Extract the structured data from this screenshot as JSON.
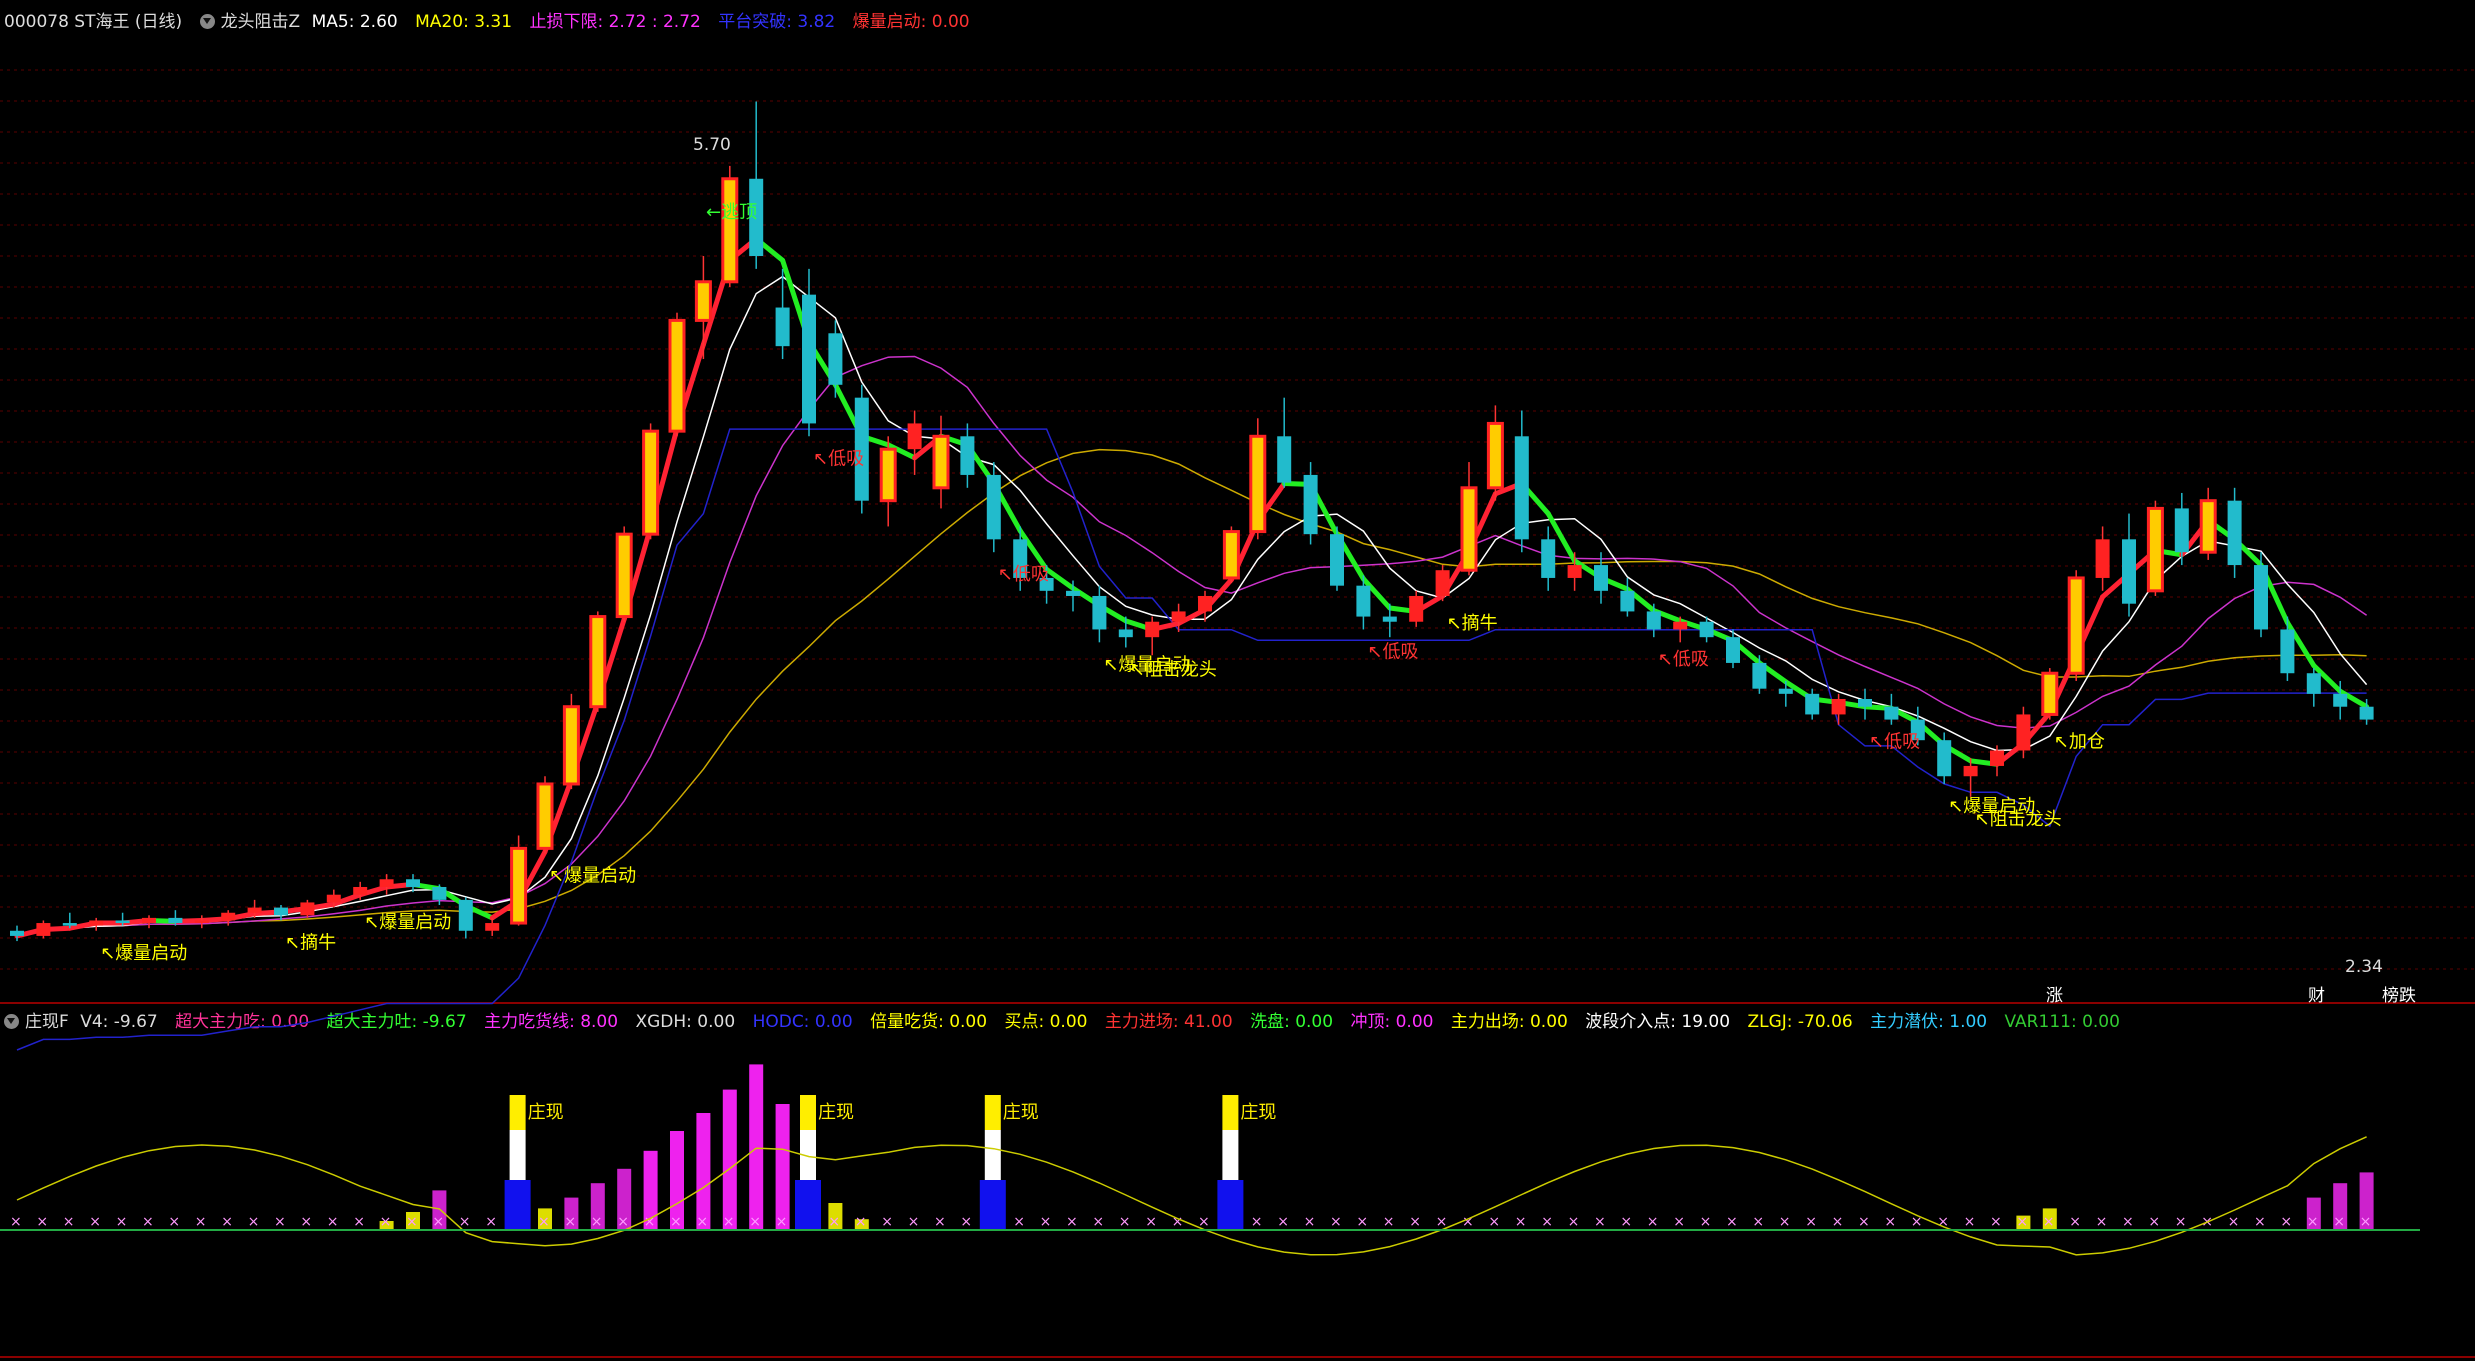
{
  "main": {
    "stock": "000078 ST海王 (日线)",
    "indicator_name": "龙头阻击Z",
    "items": [
      {
        "label": "MA5: 2.60",
        "color": "#ffffff"
      },
      {
        "label": "MA20: 3.31",
        "color": "#ffff00"
      },
      {
        "label": "止损下限: 2.72 : 2.72",
        "color": "#ff33ff"
      },
      {
        "label": "平台突破: 3.82",
        "color": "#3333ff"
      },
      {
        "label": "爆量启动: 0.00",
        "color": "#ff3333"
      }
    ]
  },
  "sub": {
    "indicator_name": "庄现F",
    "items": [
      {
        "label": "V4: -9.67",
        "color": "#dddddd"
      },
      {
        "label": "超大主力吃: 0.00",
        "color": "#ff3399"
      },
      {
        "label": "超大主力吐: -9.67",
        "color": "#33ff33"
      },
      {
        "label": "主力吃货线: 8.00",
        "color": "#ff33ff"
      },
      {
        "label": "XGDH: 0.00",
        "color": "#dddddd"
      },
      {
        "label": "HODC: 0.00",
        "color": "#3333ff"
      },
      {
        "label": "倍量吃货: 0.00",
        "color": "#ffff00"
      },
      {
        "label": "买点: 0.00",
        "color": "#ffff00"
      },
      {
        "label": "主力进场: 41.00",
        "color": "#ff3333"
      },
      {
        "label": "洗盘: 0.00",
        "color": "#33ff33"
      },
      {
        "label": "冲顶: 0.00",
        "color": "#ff33ff"
      },
      {
        "label": "主力出场: 0.00",
        "color": "#ffff00"
      },
      {
        "label": "波段介入点: 19.00",
        "color": "#ffffff"
      },
      {
        "label": "ZLGJ: -70.06",
        "color": "#ffff00"
      },
      {
        "label": "主力潜伏: 1.00",
        "color": "#33ccff"
      },
      {
        "label": "VAR111: 0.00",
        "color": "#33cc33"
      }
    ]
  },
  "markers": {
    "high_price": "5.70",
    "low_price": "2.34",
    "escape_top": "←逃顶",
    "zhang": "涨",
    "cai": "财",
    "rank": "榜跌"
  },
  "annotations": [
    {
      "text": "爆量启动",
      "color": "#ffff00",
      "bar": 3
    },
    {
      "text": "摘牛",
      "color": "#ffff00",
      "bar": 10
    },
    {
      "text": "爆量启动",
      "color": "#ffff00",
      "bar": 13
    },
    {
      "text": "爆量启动",
      "color": "#ffff00",
      "bar": 20
    },
    {
      "text": "低吸",
      "color": "#ff3333",
      "bar": 30
    },
    {
      "text": "低吸",
      "color": "#ff3333",
      "bar": 37
    },
    {
      "text": "爆量启动",
      "color": "#ffff00",
      "bar": 41
    },
    {
      "text": "阻击龙头",
      "color": "#ffff00",
      "bar": 42
    },
    {
      "text": "低吸",
      "color": "#ff3333",
      "bar": 51
    },
    {
      "text": "摘牛",
      "color": "#ffff00",
      "bar": 54
    },
    {
      "text": "低吸",
      "color": "#ff3333",
      "bar": 62
    },
    {
      "text": "低吸",
      "color": "#ff3333",
      "bar": 70
    },
    {
      "text": "爆量启动",
      "color": "#ffff00",
      "bar": 73
    },
    {
      "text": "阻击龙头",
      "color": "#ffff00",
      "bar": 74
    },
    {
      "text": "加仓",
      "color": "#ffff00",
      "bar": 77
    }
  ],
  "zhuang_label": "庄现",
  "zhuang_bars": [
    19,
    30,
    37,
    46
  ],
  "chart_data": {
    "type": "candlestick",
    "price_range": [
      2.25,
      5.9
    ],
    "categories": [
      "1",
      "2",
      "3",
      "4",
      "5",
      "6",
      "7",
      "8",
      "9",
      "10",
      "11",
      "12",
      "13",
      "14",
      "15",
      "16",
      "17",
      "18",
      "19",
      "20",
      "21",
      "22",
      "23",
      "24",
      "25",
      "26",
      "27",
      "28",
      "29",
      "30",
      "31",
      "32",
      "33",
      "34",
      "35",
      "36",
      "37",
      "38",
      "39",
      "40",
      "41",
      "42",
      "43",
      "44",
      "45",
      "46",
      "47",
      "48",
      "49",
      "50",
      "51",
      "52",
      "53",
      "54",
      "55",
      "56",
      "57",
      "58",
      "59",
      "60",
      "61",
      "62",
      "63",
      "64",
      "65",
      "66",
      "67",
      "68",
      "69",
      "70",
      "71",
      "72",
      "73",
      "74",
      "75",
      "76",
      "77",
      "78",
      "79",
      "80",
      "81",
      "82",
      "83",
      "84",
      "85",
      "86",
      "87",
      "88",
      "89",
      "90"
    ],
    "candles": [
      [
        2.48,
        2.5,
        2.44,
        2.46
      ],
      [
        2.46,
        2.52,
        2.45,
        2.51
      ],
      [
        2.51,
        2.55,
        2.49,
        2.5
      ],
      [
        2.5,
        2.53,
        2.48,
        2.52
      ],
      [
        2.52,
        2.55,
        2.5,
        2.51
      ],
      [
        2.51,
        2.54,
        2.49,
        2.53
      ],
      [
        2.53,
        2.56,
        2.5,
        2.51
      ],
      [
        2.51,
        2.54,
        2.49,
        2.52
      ],
      [
        2.52,
        2.56,
        2.5,
        2.55
      ],
      [
        2.55,
        2.6,
        2.53,
        2.57
      ],
      [
        2.57,
        2.58,
        2.52,
        2.54
      ],
      [
        2.54,
        2.6,
        2.53,
        2.59
      ],
      [
        2.59,
        2.64,
        2.57,
        2.62
      ],
      [
        2.62,
        2.67,
        2.6,
        2.65
      ],
      [
        2.65,
        2.7,
        2.62,
        2.68
      ],
      [
        2.68,
        2.7,
        2.63,
        2.65
      ],
      [
        2.65,
        2.66,
        2.58,
        2.6
      ],
      [
        2.6,
        2.61,
        2.45,
        2.48
      ],
      [
        2.48,
        2.53,
        2.46,
        2.51
      ],
      [
        2.51,
        2.85,
        2.5,
        2.8
      ],
      [
        2.8,
        3.08,
        2.78,
        3.05
      ],
      [
        3.05,
        3.4,
        3.03,
        3.35
      ],
      [
        3.35,
        3.72,
        3.33,
        3.7
      ],
      [
        3.7,
        4.05,
        3.68,
        4.02
      ],
      [
        4.02,
        4.45,
        4.0,
        4.42
      ],
      [
        4.42,
        4.88,
        4.4,
        4.85
      ],
      [
        4.85,
        5.1,
        4.7,
        5.0
      ],
      [
        5.0,
        5.45,
        4.98,
        5.4
      ],
      [
        5.4,
        5.7,
        5.05,
        5.1
      ],
      [
        4.9,
        5.05,
        4.7,
        4.75
      ],
      [
        4.95,
        5.05,
        4.4,
        4.45
      ],
      [
        4.8,
        4.85,
        4.55,
        4.6
      ],
      [
        4.55,
        4.6,
        4.1,
        4.15
      ],
      [
        4.15,
        4.4,
        4.05,
        4.35
      ],
      [
        4.35,
        4.5,
        4.25,
        4.45
      ],
      [
        4.2,
        4.48,
        4.12,
        4.4
      ],
      [
        4.4,
        4.45,
        4.2,
        4.25
      ],
      [
        4.25,
        4.3,
        3.95,
        4.0
      ],
      [
        4.0,
        4.05,
        3.8,
        3.85
      ],
      [
        3.85,
        3.9,
        3.75,
        3.8
      ],
      [
        3.8,
        3.84,
        3.72,
        3.78
      ],
      [
        3.78,
        3.82,
        3.6,
        3.65
      ],
      [
        3.65,
        3.7,
        3.58,
        3.62
      ],
      [
        3.62,
        3.7,
        3.55,
        3.68
      ],
      [
        3.68,
        3.75,
        3.64,
        3.72
      ],
      [
        3.72,
        3.8,
        3.68,
        3.78
      ],
      [
        3.85,
        4.05,
        3.83,
        4.03
      ],
      [
        4.03,
        4.47,
        4.0,
        4.4
      ],
      [
        4.4,
        4.55,
        4.2,
        4.22
      ],
      [
        4.25,
        4.3,
        3.98,
        4.02
      ],
      [
        4.02,
        4.05,
        3.8,
        3.82
      ],
      [
        3.82,
        3.86,
        3.65,
        3.7
      ],
      [
        3.7,
        3.75,
        3.62,
        3.68
      ],
      [
        3.68,
        3.8,
        3.66,
        3.78
      ],
      [
        3.78,
        3.9,
        3.76,
        3.88
      ],
      [
        3.88,
        4.3,
        3.86,
        4.2
      ],
      [
        4.2,
        4.52,
        4.15,
        4.45
      ],
      [
        4.4,
        4.5,
        3.95,
        4.0
      ],
      [
        4.0,
        4.05,
        3.8,
        3.85
      ],
      [
        3.85,
        3.95,
        3.8,
        3.9
      ],
      [
        3.9,
        3.95,
        3.75,
        3.8
      ],
      [
        3.8,
        3.85,
        3.7,
        3.72
      ],
      [
        3.72,
        3.75,
        3.62,
        3.65
      ],
      [
        3.65,
        3.7,
        3.6,
        3.68
      ],
      [
        3.68,
        3.7,
        3.6,
        3.62
      ],
      [
        3.62,
        3.65,
        3.5,
        3.52
      ],
      [
        3.52,
        3.55,
        3.4,
        3.42
      ],
      [
        3.42,
        3.45,
        3.35,
        3.4
      ],
      [
        3.4,
        3.42,
        3.3,
        3.32
      ],
      [
        3.32,
        3.4,
        3.28,
        3.38
      ],
      [
        3.38,
        3.42,
        3.3,
        3.35
      ],
      [
        3.35,
        3.4,
        3.28,
        3.3
      ],
      [
        3.3,
        3.35,
        3.2,
        3.22
      ],
      [
        3.22,
        3.25,
        3.05,
        3.08
      ],
      [
        3.08,
        3.15,
        3.0,
        3.12
      ],
      [
        3.12,
        3.2,
        3.08,
        3.18
      ],
      [
        3.18,
        3.35,
        3.15,
        3.32
      ],
      [
        3.32,
        3.5,
        3.3,
        3.48
      ],
      [
        3.48,
        3.88,
        3.45,
        3.85
      ],
      [
        3.85,
        4.05,
        3.8,
        4.0
      ],
      [
        4.0,
        4.1,
        3.7,
        3.75
      ],
      [
        3.8,
        4.15,
        3.78,
        4.12
      ],
      [
        4.12,
        4.18,
        3.9,
        3.95
      ],
      [
        3.95,
        4.2,
        3.92,
        4.15
      ],
      [
        4.15,
        4.2,
        3.85,
        3.9
      ],
      [
        3.9,
        3.95,
        3.62,
        3.65
      ],
      [
        3.65,
        3.7,
        3.45,
        3.48
      ],
      [
        3.48,
        3.5,
        3.35,
        3.4
      ],
      [
        3.4,
        3.45,
        3.3,
        3.35
      ],
      [
        3.35,
        3.38,
        3.28,
        3.3
      ]
    ],
    "sub_range": [
      -80,
      100
    ],
    "sub_values": [
      0,
      0,
      0,
      0,
      0,
      0,
      0,
      0,
      0,
      0,
      0,
      0,
      0,
      0,
      5,
      10,
      22,
      0,
      0,
      8,
      12,
      18,
      26,
      34,
      44,
      55,
      65,
      78,
      92,
      70,
      38,
      15,
      6,
      0,
      0,
      0,
      0,
      0,
      0,
      0,
      0,
      0,
      0,
      0,
      0,
      0,
      0,
      0,
      0,
      0,
      0,
      0,
      0,
      0,
      0,
      0,
      0,
      0,
      0,
      0,
      0,
      0,
      0,
      0,
      0,
      0,
      0,
      0,
      0,
      0,
      0,
      0,
      0,
      0,
      0,
      0,
      8,
      12,
      0,
      0,
      0,
      0,
      0,
      0,
      0,
      0,
      0,
      18,
      26,
      32
    ]
  }
}
